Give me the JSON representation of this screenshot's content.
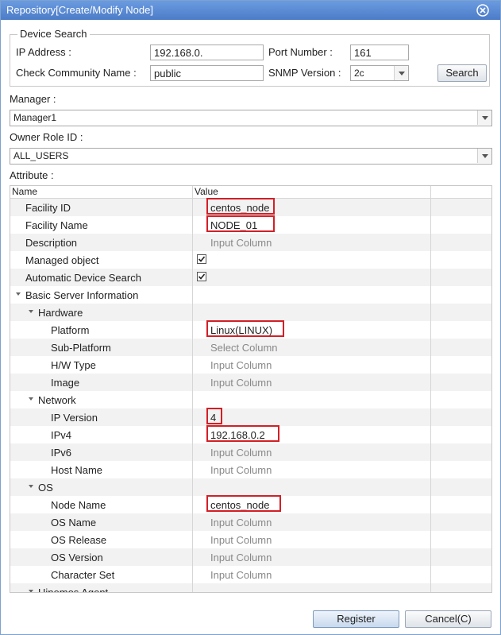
{
  "window": {
    "title": "Repository[Create/Modify Node]"
  },
  "device_search": {
    "legend": "Device Search",
    "ip_label": "IP Address :",
    "ip_value": "192.168.0.",
    "port_label": "Port Number :",
    "port_value": "161",
    "community_label": "Check Community Name :",
    "community_value": "public",
    "snmp_label": "SNMP Version :",
    "snmp_value": "2c",
    "search_button": "Search"
  },
  "manager": {
    "label": "Manager :",
    "value": "Manager1"
  },
  "owner_role": {
    "label": "Owner Role ID :",
    "value": "ALL_USERS"
  },
  "attribute": {
    "label": "Attribute :",
    "columns": [
      "Name",
      "Value"
    ],
    "rows": [
      {
        "name": "Facility ID",
        "value": "centos_node"
      },
      {
        "name": "Facility Name",
        "value": "NODE_01"
      },
      {
        "name": "Description",
        "value": "Input Column"
      },
      {
        "name": "Managed object",
        "value": ""
      },
      {
        "name": "Automatic Device Search",
        "value": ""
      },
      {
        "name": "Basic Server Information",
        "value": ""
      },
      {
        "name": "Hardware",
        "value": ""
      },
      {
        "name": "Platform",
        "value": "Linux(LINUX)"
      },
      {
        "name": "Sub-Platform",
        "value": "Select Column"
      },
      {
        "name": "H/W Type",
        "value": "Input Column"
      },
      {
        "name": "Image",
        "value": "Input Column"
      },
      {
        "name": "Network",
        "value": ""
      },
      {
        "name": "IP Version",
        "value": "4"
      },
      {
        "name": "IPv4",
        "value": "192.168.0.2"
      },
      {
        "name": "IPv6",
        "value": "Input Column"
      },
      {
        "name": "Host Name",
        "value": "Input Column"
      },
      {
        "name": "OS",
        "value": ""
      },
      {
        "name": "Node Name",
        "value": "centos_node"
      },
      {
        "name": "OS Name",
        "value": "Input Column"
      },
      {
        "name": "OS Release",
        "value": "Input Column"
      },
      {
        "name": "OS Version",
        "value": "Input Column"
      },
      {
        "name": "Character Set",
        "value": "Input Column"
      },
      {
        "name": "Hinemos Agent",
        "value": ""
      }
    ]
  },
  "buttons": {
    "register": "Register",
    "cancel": "Cancel(C)"
  },
  "colors": {
    "titlebar": "#5a8ad2",
    "highlight": "#d31f26"
  }
}
